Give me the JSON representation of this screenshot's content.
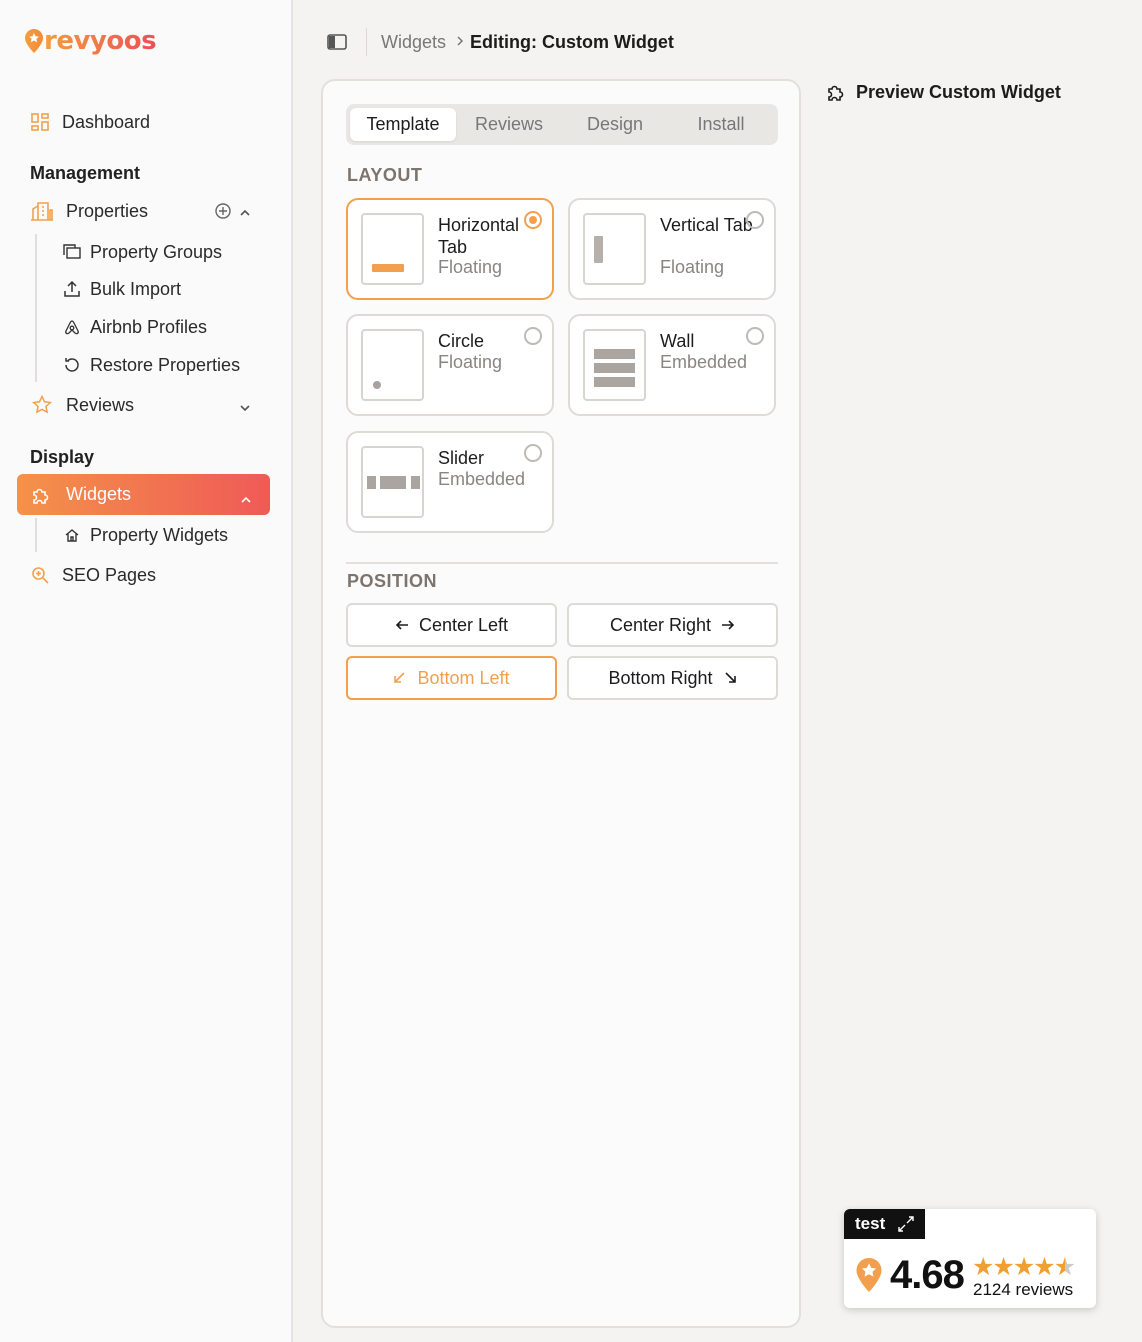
{
  "brand": {
    "name": "revyoos",
    "accent": "#f3a04e",
    "gradient_start": "#f4924a",
    "gradient_end": "#ef5a57"
  },
  "sidebar": {
    "dashboard": "Dashboard",
    "management_label": "Management",
    "properties": "Properties",
    "property_groups": "Property Groups",
    "bulk_import": "Bulk Import",
    "airbnb_profiles": "Airbnb Profiles",
    "restore_properties": "Restore Properties",
    "reviews": "Reviews",
    "display_label": "Display",
    "widgets": "Widgets",
    "property_widgets": "Property Widgets",
    "seo_pages": "SEO Pages"
  },
  "breadcrumb": {
    "parent": "Widgets",
    "current": "Editing: Custom Widget"
  },
  "tabs": [
    {
      "label": "Template",
      "selected": true
    },
    {
      "label": "Reviews",
      "selected": false
    },
    {
      "label": "Design",
      "selected": false
    },
    {
      "label": "Install",
      "selected": false
    }
  ],
  "layout": {
    "label": "LAYOUT",
    "options": [
      {
        "title": "Horizontal Tab",
        "sub": "Floating",
        "selected": true
      },
      {
        "title": "Vertical Tab",
        "sub": "Floating",
        "selected": false
      },
      {
        "title": "Circle",
        "sub": "Floating",
        "selected": false
      },
      {
        "title": "Wall",
        "sub": "Embedded",
        "selected": false
      },
      {
        "title": "Slider",
        "sub": "Embedded",
        "selected": false
      }
    ]
  },
  "position": {
    "label": "POSITION",
    "center_left": "Center Left",
    "center_right": "Center Right",
    "bottom_left": "Bottom Left",
    "bottom_right": "Bottom Right",
    "selected": "Bottom Left"
  },
  "preview": {
    "title": "Preview Custom Widget",
    "widget": {
      "tab_label": "test",
      "score": "4.68",
      "reviews": "2124 reviews",
      "rating": 4.68
    }
  }
}
